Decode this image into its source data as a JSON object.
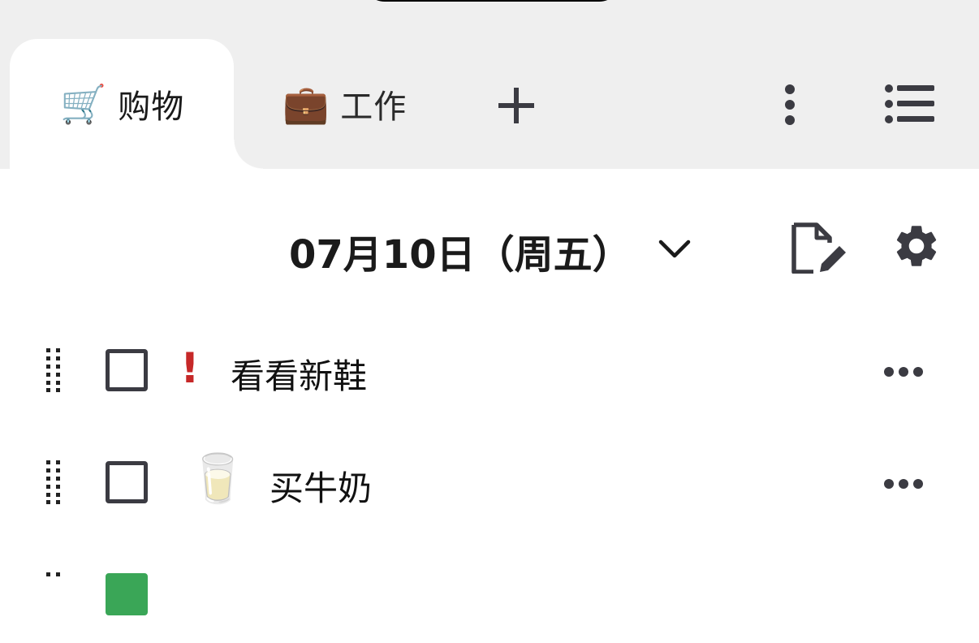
{
  "tabs": [
    {
      "emoji": "🛒",
      "label": "购物",
      "active": true
    },
    {
      "emoji": "💼",
      "label": "工作",
      "active": false
    }
  ],
  "header": {
    "date": "07月10日（周五）"
  },
  "tasks": [
    {
      "text": "看看新鞋",
      "priority_mark": "!",
      "emoji": "",
      "checked": false
    },
    {
      "text": "买牛奶",
      "priority_mark": "",
      "emoji": "🥛",
      "checked": false
    },
    {
      "text": "",
      "priority_mark": "",
      "emoji": "",
      "checked": true
    }
  ],
  "icons": {
    "add": "plus-icon",
    "more_tabs": "more-vertical-icon",
    "list": "list-icon",
    "date_dropdown": "chevron-down-icon",
    "edit": "edit-note-icon",
    "settings": "gear-icon",
    "drag": "drag-handle-icon",
    "task_more": "more-horizontal-icon"
  },
  "colors": {
    "tab_bar_bg": "#efefef",
    "priority": "#c62828",
    "checkbox_border": "#3b3b42",
    "checked_green": "#3aa657",
    "icon_dark": "#3b3b42"
  }
}
